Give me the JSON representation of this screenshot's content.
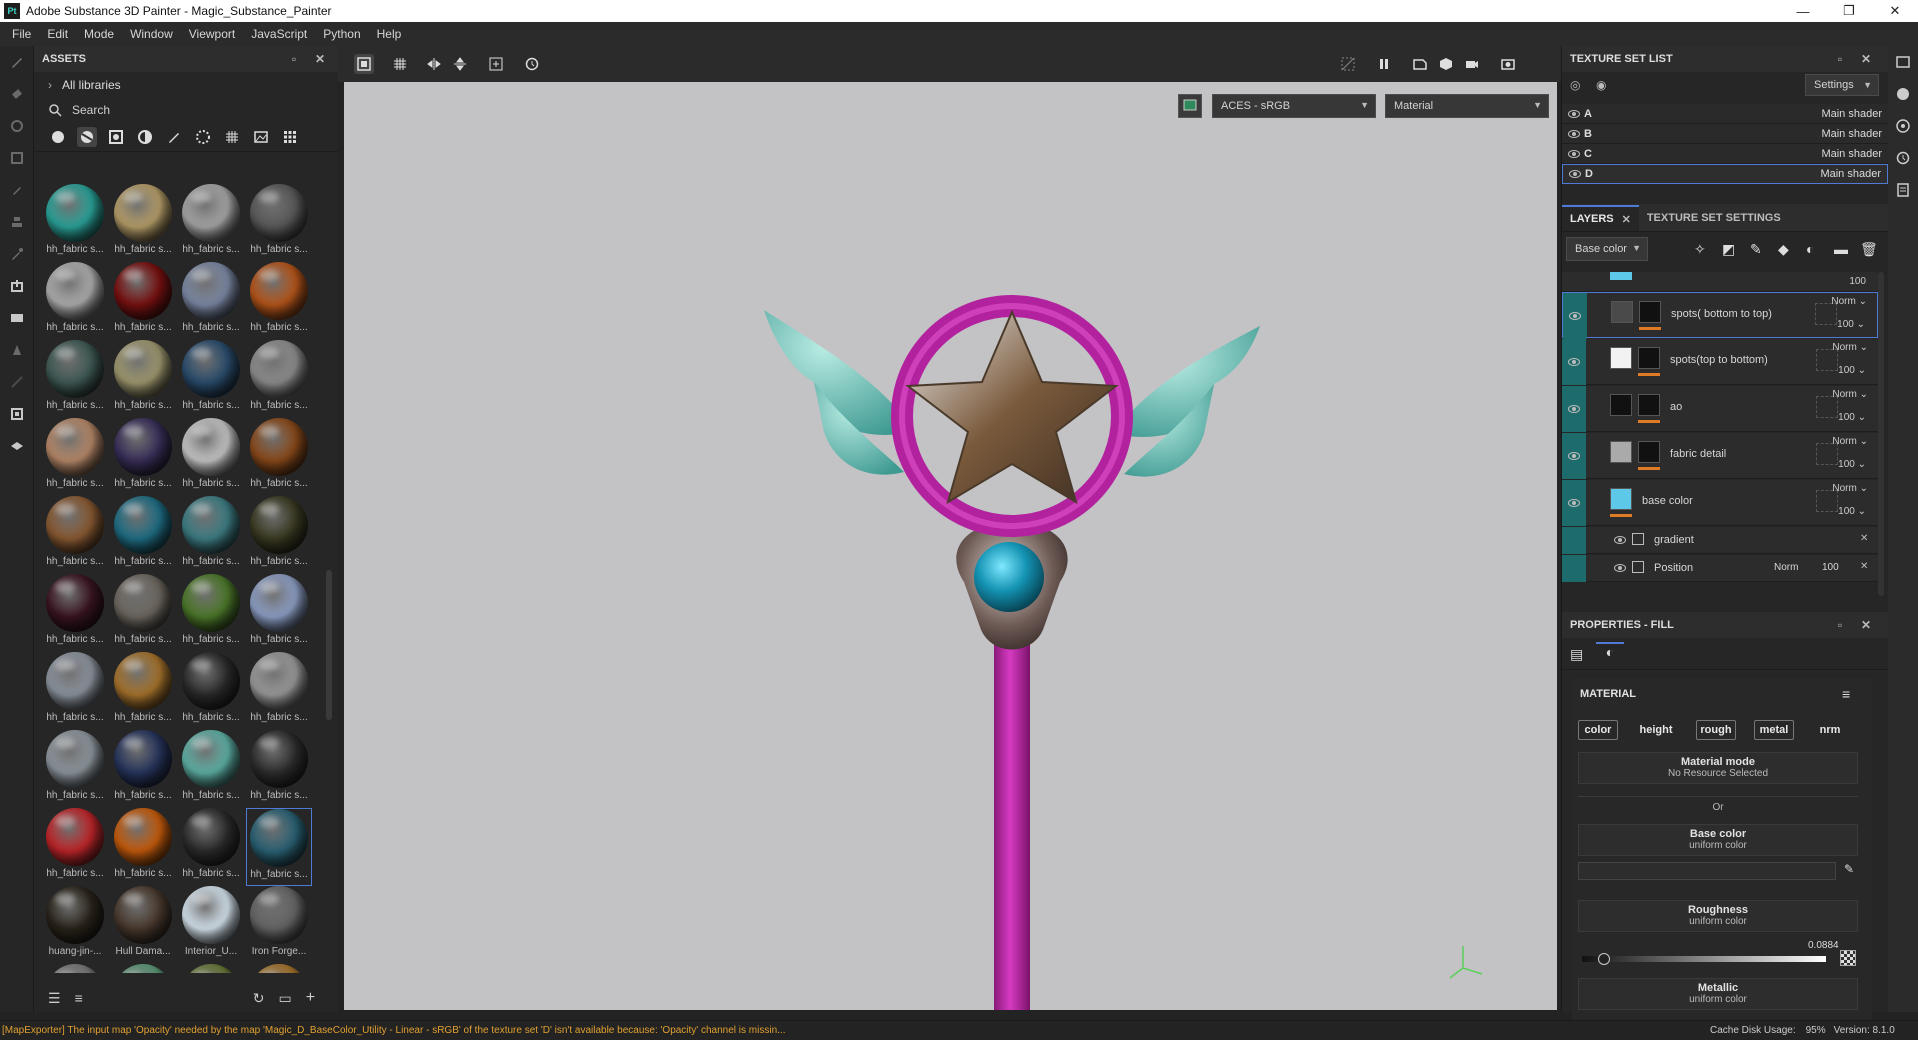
{
  "window": {
    "title": "Adobe Substance 3D Painter - Magic_Substance_Painter",
    "logo_text": "Pt",
    "minimize": "—",
    "maximize": "❐",
    "close": "✕"
  },
  "menu": [
    "File",
    "Edit",
    "Mode",
    "Window",
    "Viewport",
    "JavaScript",
    "Python",
    "Help"
  ],
  "assets": {
    "title": "ASSETS",
    "libraries": "All libraries",
    "search_placeholder": "Search",
    "tiles": [
      {
        "label": "hh_fabric s...",
        "color": "#2aa59b"
      },
      {
        "label": "hh_fabric s...",
        "color": "#b8a06a"
      },
      {
        "label": "hh_fabric s...",
        "color": "#a9a9a9"
      },
      {
        "label": "hh_fabric s...",
        "color": "#5a5a5a"
      },
      {
        "label": "hh_fabric s...",
        "color": "#b0b0b0"
      },
      {
        "label": "hh_fabric s...",
        "color": "#7a1010"
      },
      {
        "label": "hh_fabric s...",
        "color": "#7d8aa6"
      },
      {
        "label": "hh_fabric s...",
        "color": "#b8561a"
      },
      {
        "label": "hh_fabric s...",
        "color": "#3f5a55"
      },
      {
        "label": "hh_fabric s...",
        "color": "#a09a70"
      },
      {
        "label": "hh_fabric s...",
        "color": "#2a4d6e"
      },
      {
        "label": "hh_fabric s...",
        "color": "#8f8f8f"
      },
      {
        "label": "hh_fabric s...",
        "color": "#b98a6a"
      },
      {
        "label": "hh_fabric s...",
        "color": "#3a2f5a"
      },
      {
        "label": "hh_fabric s...",
        "color": "#c9c9c9"
      },
      {
        "label": "hh_fabric s...",
        "color": "#8b4a1a"
      },
      {
        "label": "hh_fabric s...",
        "color": "#8a5a32"
      },
      {
        "label": "hh_fabric s...",
        "color": "#1f6f86"
      },
      {
        "label": "hh_fabric s...",
        "color": "#3e7f86"
      },
      {
        "label": "hh_fabric s...",
        "color": "#3a3a22"
      },
      {
        "label": "hh_fabric s...",
        "color": "#3a1422"
      },
      {
        "label": "hh_fabric s...",
        "color": "#6e6860"
      },
      {
        "label": "hh_fabric s...",
        "color": "#4d7a2a"
      },
      {
        "label": "hh_fabric s...",
        "color": "#8fa1c8"
      },
      {
        "label": "hh_fabric s...",
        "color": "#8e96a0"
      },
      {
        "label": "hh_fabric s...",
        "color": "#a8742c"
      },
      {
        "label": "hh_fabric s...",
        "color": "#2a2a2a"
      },
      {
        "label": "hh_fabric s...",
        "color": "#9c9c9c"
      },
      {
        "label": "hh_fabric s...",
        "color": "#8f98a0"
      },
      {
        "label": "hh_fabric s...",
        "color": "#27355e"
      },
      {
        "label": "hh_fabric s...",
        "color": "#5fb3a8"
      },
      {
        "label": "hh_fabric s...",
        "color": "#2d2d2d"
      },
      {
        "label": "hh_fabric s...",
        "color": "#c2262a"
      },
      {
        "label": "hh_fabric s...",
        "color": "#c85c0c"
      },
      {
        "label": "hh_fabric s...",
        "color": "#2c2c2c"
      },
      {
        "label": "hh_fabric s...",
        "color": "#2a6376"
      },
      {
        "label": "huang-jin-...",
        "color": "#2a241a"
      },
      {
        "label": "Hull Dama...",
        "color": "#4a3a2e"
      },
      {
        "label": "Interior_U...",
        "color": "#d8e6f0"
      },
      {
        "label": "Iron Forge...",
        "color": "#666666"
      },
      {
        "label": "",
        "color": "#7a7a7a"
      },
      {
        "label": "",
        "color": "#5e9a7a"
      },
      {
        "label": "",
        "color": "#6a7a3a"
      },
      {
        "label": "",
        "color": "#a8762c"
      }
    ]
  },
  "viewport": {
    "colorspace": "ACES - sRGB",
    "channel": "Material"
  },
  "texture_set_list": {
    "title": "TEXTURE SET LIST",
    "settings": "Settings",
    "sets": [
      {
        "name": "A",
        "shader": "Main shader"
      },
      {
        "name": "B",
        "shader": "Main shader"
      },
      {
        "name": "C",
        "shader": "Main shader"
      },
      {
        "name": "D",
        "shader": "Main shader"
      }
    ]
  },
  "layers": {
    "tab_layers": "LAYERS",
    "tab_tss": "TEXTURE SET SETTINGS",
    "channel": "Base color",
    "top_partial": {
      "opacity": "100"
    },
    "items": [
      {
        "name": "spots( bottom to top)",
        "mode": "Norm",
        "opacity": "100",
        "thumb": "#4a4a4a"
      },
      {
        "name": "spots(top to bottom)",
        "mode": "Norm",
        "opacity": "100",
        "thumb": "#f2f2f2"
      },
      {
        "name": "ao",
        "mode": "Norm",
        "opacity": "100",
        "thumb": "#111111"
      },
      {
        "name": "fabric detail",
        "mode": "Norm",
        "opacity": "100",
        "thumb": "#aaaaaa"
      },
      {
        "name": "base color",
        "mode": "Norm",
        "opacity": "100",
        "thumb": "#5ec8e8"
      }
    ],
    "sub": [
      {
        "name": "gradient",
        "mode": "",
        "opacity": ""
      },
      {
        "name": "Position",
        "mode": "Norm",
        "opacity": "100"
      }
    ]
  },
  "properties": {
    "title": "PROPERTIES - FILL",
    "section": "MATERIAL",
    "channels": [
      "color",
      "height",
      "rough",
      "metal",
      "nrm"
    ],
    "material_mode": {
      "title": "Material mode",
      "sub": "No Resource Selected"
    },
    "or": "Or",
    "base_color": {
      "title": "Base color",
      "sub": "uniform color"
    },
    "roughness": {
      "title": "Roughness",
      "sub": "uniform color",
      "value": "0.0884"
    },
    "metallic": {
      "title": "Metallic",
      "sub": "uniform color"
    }
  },
  "status": {
    "message": "[MapExporter] The input map 'Opacity' needed by the map 'Magic_D_BaseColor_Utility - Linear - sRGB' of the texture set 'D' isn't available because: 'Opacity' channel is missin...",
    "cache": "Cache Disk Usage:",
    "cache_value": "95%",
    "version": "Version: 8.1.0"
  }
}
